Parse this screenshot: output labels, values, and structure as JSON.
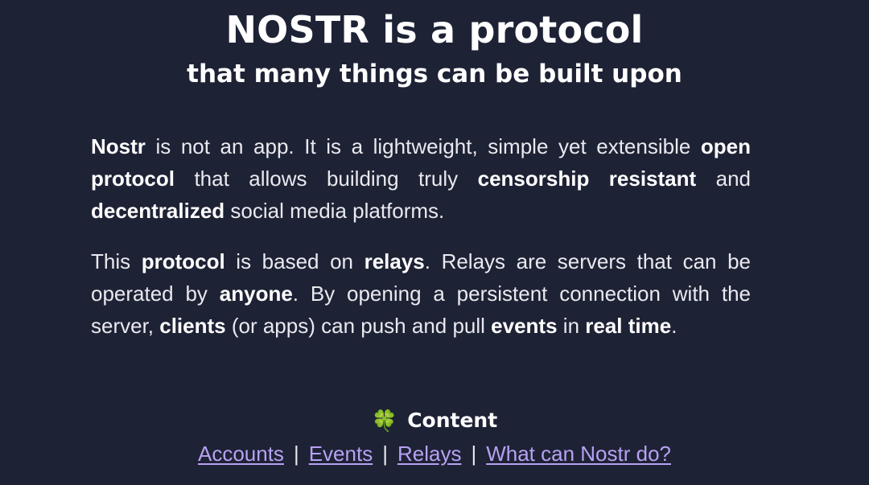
{
  "hero": {
    "title": "NOSTR is a protocol",
    "subtitle": "that many things can be built upon"
  },
  "intro": {
    "p1": {
      "s1": "Nostr",
      "t1": " is not an app. It is a lightweight, simple yet extensible ",
      "s2": "open protocol",
      "t2": " that allows building truly ",
      "s3": "censorship resistant",
      "t3": " and ",
      "s4": "decentralized",
      "t4": " social media platforms."
    },
    "p2": {
      "t1": "This ",
      "s1": "protocol",
      "t2": " is based on ",
      "s2": "relays",
      "t3": ". Relays are servers that can be operated by ",
      "s3": "anyone",
      "t4": ". By opening a persistent connection with the server, ",
      "s4": "clients",
      "t5": " (or apps) can push and pull ",
      "s5": "events",
      "t6": " in ",
      "s6": "real time",
      "t7": "."
    }
  },
  "content": {
    "icon": "four-leaf-clover-icon",
    "icon_glyph": "🍀",
    "icon_color": "#1fb85a",
    "heading": "Content",
    "separator": "|",
    "links": [
      "Accounts",
      "Events",
      "Relays",
      "What can Nostr do?"
    ]
  },
  "colors": {
    "background": "#1e2235",
    "text": "#e9e9ef",
    "link": "#b6a2f2"
  }
}
